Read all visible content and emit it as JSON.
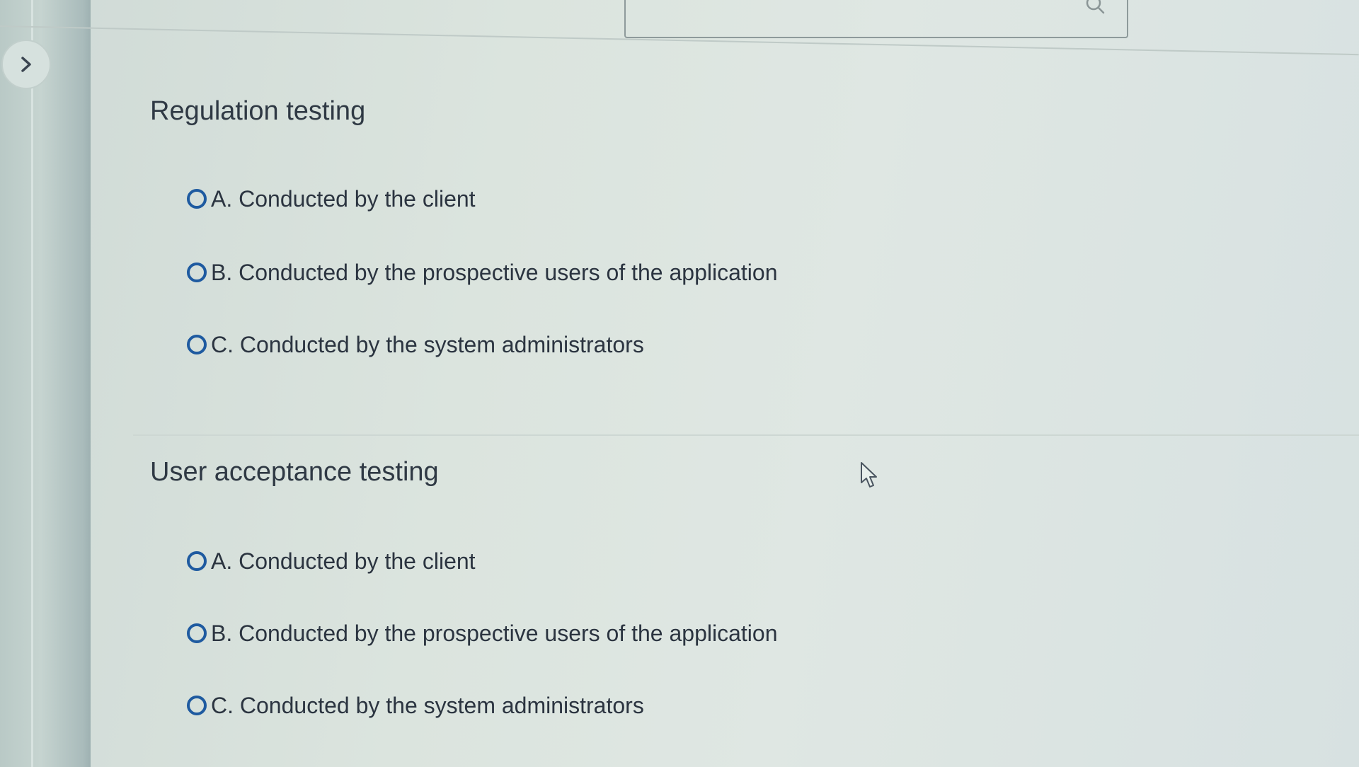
{
  "header": {
    "search": {
      "placeholder": "",
      "icon": "search-icon"
    }
  },
  "sidebar": {
    "toggle_icon": "chevron-right-icon"
  },
  "questions": [
    {
      "title": "Regulation testing",
      "options": [
        {
          "label": "A. Conducted by the client"
        },
        {
          "label": "B. Conducted by the prospective users of the application"
        },
        {
          "label": "C. Conducted by the system administrators"
        }
      ]
    },
    {
      "title": "User acceptance testing",
      "options": [
        {
          "label": "A. Conducted by the client"
        },
        {
          "label": "B. Conducted by the prospective users of the application"
        },
        {
          "label": "C. Conducted by the system administrators"
        }
      ]
    }
  ],
  "colors": {
    "radio_border": "#1e5aa0",
    "text": "#2b3440"
  }
}
